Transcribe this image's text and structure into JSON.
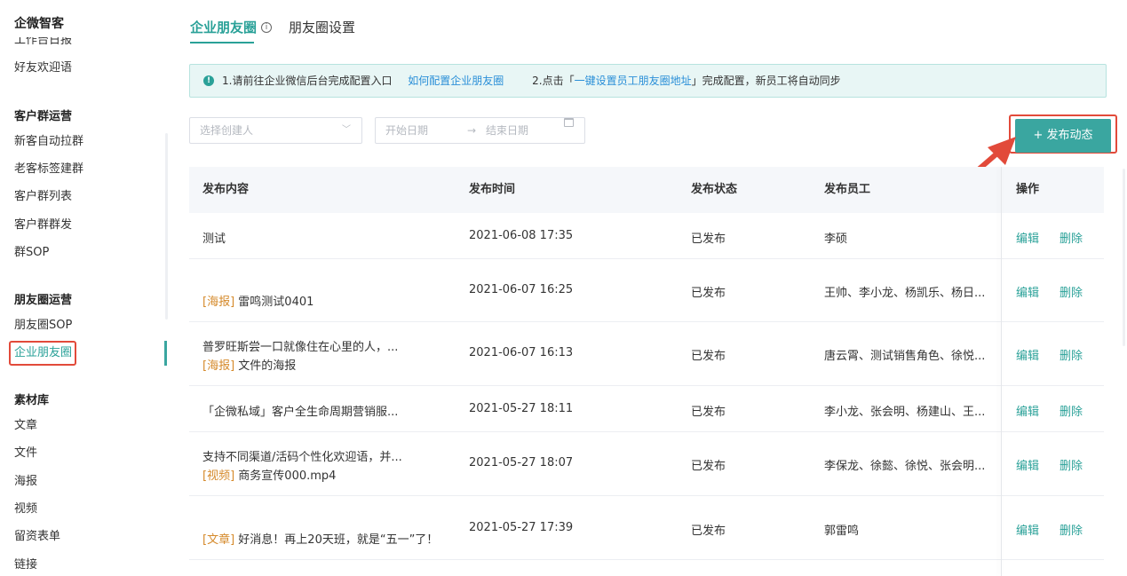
{
  "sidebar": {
    "brand": "企微智客",
    "cut_item": "工作台日报",
    "welcome": "好友欢迎语",
    "groups": [
      {
        "title": "客户群运营",
        "items": [
          "新客自动拉群",
          "老客标签建群",
          "客户群列表",
          "客户群群发",
          "群SOP"
        ]
      },
      {
        "title": "朋友圈运营",
        "items": [
          "朋友圈SOP",
          "企业朋友圈"
        ]
      },
      {
        "title": "素材库",
        "items": [
          "文章",
          "文件",
          "海报",
          "视频",
          "留资表单",
          "链接"
        ]
      }
    ]
  },
  "tabs": {
    "active": "企业朋友圈",
    "other": "朋友圈设置",
    "info_icon": "ⓘ"
  },
  "notice": {
    "part1": "1.请前往企业微信后台完成配置入口",
    "link1": "如何配置企业朋友圈",
    "part2": "2.点击「",
    "link2": "一键设置员工朋友圈地址",
    "part3": "」完成配置，新员工将自动同步"
  },
  "filters": {
    "creator_placeholder": "选择创建人",
    "start_placeholder": "开始日期",
    "range_sep": "→",
    "end_placeholder": "结束日期"
  },
  "publish_button": "+  发布动态",
  "table": {
    "headers": [
      "发布内容",
      "发布时间",
      "发布状态",
      "发布员工",
      "操作"
    ],
    "rows": [
      {
        "line1": "测试",
        "tag": "",
        "line2": "",
        "time": "2021-06-08 17:35",
        "status": "已发布",
        "staff": "李硕"
      },
      {
        "line1": "",
        "tag": "[海报]",
        "line2": "雷鸣测试0401",
        "time": "2021-06-07 16:25",
        "status": "已发布",
        "staff": "王帅、李小龙、杨凯乐、杨日..."
      },
      {
        "line1": "普罗旺斯尝一口就像住在心里的人，...",
        "tag": "[海报]",
        "line2": "文件的海报",
        "time": "2021-06-07 16:13",
        "status": "已发布",
        "staff": "唐云霄、测试销售角色、徐悦..."
      },
      {
        "line1": "「企微私域」客户全生命周期营销服...",
        "tag": "",
        "line2": "",
        "time": "2021-05-27 18:11",
        "status": "已发布",
        "staff": "李小龙、张会明、杨建山、王..."
      },
      {
        "line1": "支持不同渠道/活码个性化欢迎语，并...",
        "tag": "[视频]",
        "line2": "商务宣传000.mp4",
        "time": "2021-05-27 18:07",
        "status": "已发布",
        "staff": "李保龙、徐懿、徐悦、张会明..."
      },
      {
        "line1": "",
        "tag": "[文章]",
        "line2": "好消息！再上20天班，就是“五一”了！",
        "time": "2021-05-27 17:39",
        "status": "已发布",
        "staff": "郭雷鸣"
      }
    ],
    "edit_label": "编辑",
    "delete_label": "删除"
  },
  "colors": {
    "accent": "#2aa198",
    "button": "#3aa6a0",
    "highlight_box": "#e24a3a",
    "tag": "#d58a2b"
  }
}
